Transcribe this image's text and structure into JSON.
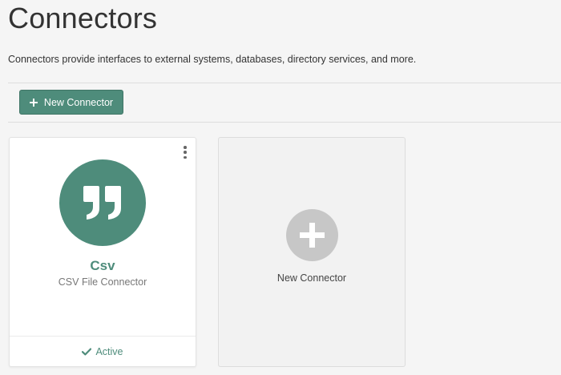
{
  "page": {
    "title": "Connectors",
    "description": "Connectors provide interfaces to external systems, databases, directory services, and more."
  },
  "toolbar": {
    "new_connector_label": "New Connector",
    "new_connector_icon": "plus-icon"
  },
  "connectors": [
    {
      "name": "Csv",
      "type": "CSV File Connector",
      "icon": "quote-icon",
      "status": "Active",
      "status_icon": "check-icon",
      "menu_icon": "kebab-menu-icon"
    }
  ],
  "new_card": {
    "label": "New Connector",
    "icon": "add-circle-icon"
  },
  "colors": {
    "accent": "#4e8c7b",
    "background": "#f5f5f5",
    "add_circle": "#c7c7c7"
  }
}
